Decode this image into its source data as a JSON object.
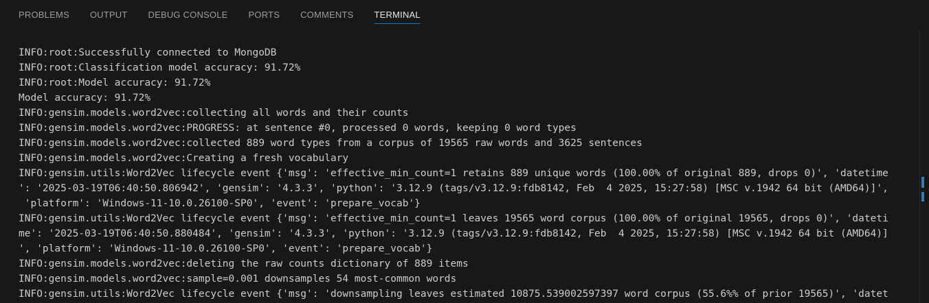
{
  "tabs": [
    {
      "label": "PROBLEMS"
    },
    {
      "label": "OUTPUT"
    },
    {
      "label": "DEBUG CONSOLE"
    },
    {
      "label": "PORTS"
    },
    {
      "label": "COMMENTS"
    },
    {
      "label": "TERMINAL",
      "active": true
    }
  ],
  "terminal": {
    "lines": [
      "INFO:root:Successfully connected to MongoDB",
      "INFO:root:Classification model accuracy: 91.72%",
      "INFO:root:Model accuracy: 91.72%",
      "Model accuracy: 91.72%",
      "INFO:gensim.models.word2vec:collecting all words and their counts",
      "INFO:gensim.models.word2vec:PROGRESS: at sentence #0, processed 0 words, keeping 0 word types",
      "INFO:gensim.models.word2vec:collected 889 word types from a corpus of 19565 raw words and 3625 sentences",
      "INFO:gensim.models.word2vec:Creating a fresh vocabulary",
      "INFO:gensim.utils:Word2Vec lifecycle event {'msg': 'effective_min_count=1 retains 889 unique words (100.00% of original 889, drops 0)', 'datetime",
      "': '2025-03-19T06:40:50.806942', 'gensim': '4.3.3', 'python': '3.12.9 (tags/v3.12.9:fdb8142, Feb  4 2025, 15:27:58) [MSC v.1942 64 bit (AMD64)]',",
      " 'platform': 'Windows-11-10.0.26100-SP0', 'event': 'prepare_vocab'}",
      "INFO:gensim.utils:Word2Vec lifecycle event {'msg': 'effective_min_count=1 leaves 19565 word corpus (100.00% of original 19565, drops 0)', 'dateti",
      "me': '2025-03-19T06:40:50.880484', 'gensim': '4.3.3', 'python': '3.12.9 (tags/v3.12.9:fdb8142, Feb  4 2025, 15:27:58) [MSC v.1942 64 bit (AMD64)]",
      "', 'platform': 'Windows-11-10.0.26100-SP0', 'event': 'prepare_vocab'}",
      "INFO:gensim.models.word2vec:deleting the raw counts dictionary of 889 items",
      "INFO:gensim.models.word2vec:sample=0.001 downsamples 54 most-common words",
      "INFO:gensim.utils:Word2Vec lifecycle event {'msg': 'downsampling leaves estimated 10875.539002597397 word corpus (55.6%% of prior 19565)', 'datet"
    ]
  }
}
